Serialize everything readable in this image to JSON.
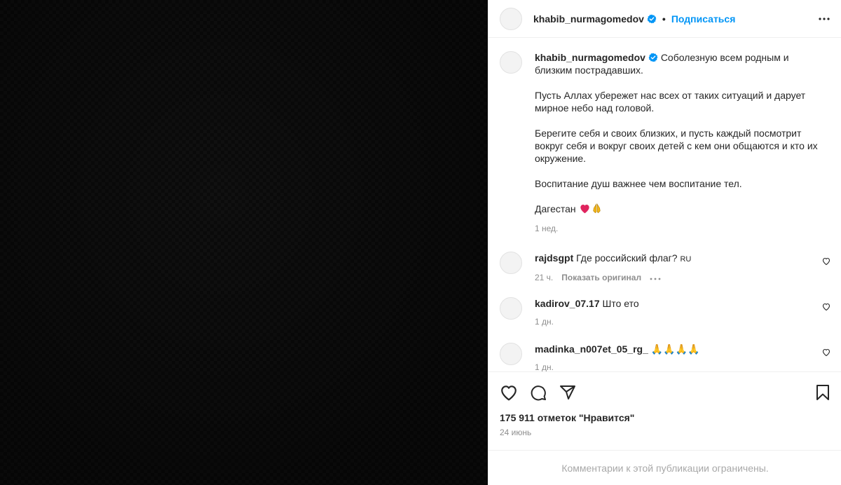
{
  "header": {
    "username": "khabib_nurmagomedov",
    "separator": "•",
    "follow_label": "Подписаться"
  },
  "caption": {
    "username": "khabib_nurmagomedov",
    "text_p1": "Соболезную всем родным и\nблизким пострадавших.",
    "text_p2": "Пусть Аллах убережет нас всех от таких ситуаций и дарует мирное небо над головой.",
    "text_p3": "Берегите себя и своих близких, и пусть каждый посмотрит вокруг себя и вокруг своих детей с кем они общаются и кто их окружение.",
    "text_p4": "Воспитание душ важнее чем воспитание тел.",
    "text_p5": "Дагестан",
    "time": "1 нед."
  },
  "comments": [
    {
      "username": "rajdsgpt",
      "text": "Где российский флаг?",
      "lang": "RU",
      "time": "21 ч.",
      "show_original": "Показать оригинал"
    },
    {
      "username": "kadirov_07.17",
      "text": "Што ето",
      "time": "1 дн."
    },
    {
      "username": "madinka_n007et_05_rg_",
      "text": "🙏🙏🙏🙏",
      "time": "1 дн."
    }
  ],
  "post": {
    "likes": "175 911 отметок \"Нравится\"",
    "date": "24 июнь",
    "comments_restricted": "Комментарии к этой публикации ограничены."
  },
  "icons": {
    "like": "heart-icon",
    "comment": "comment-icon",
    "share": "share-icon",
    "save": "bookmark-icon",
    "more": "more-icon",
    "verified": "verified-badge-icon"
  },
  "colors": {
    "accent": "#0095f6",
    "text": "#262626",
    "muted": "#8e8e8e",
    "heart_red": "#e0245e"
  }
}
